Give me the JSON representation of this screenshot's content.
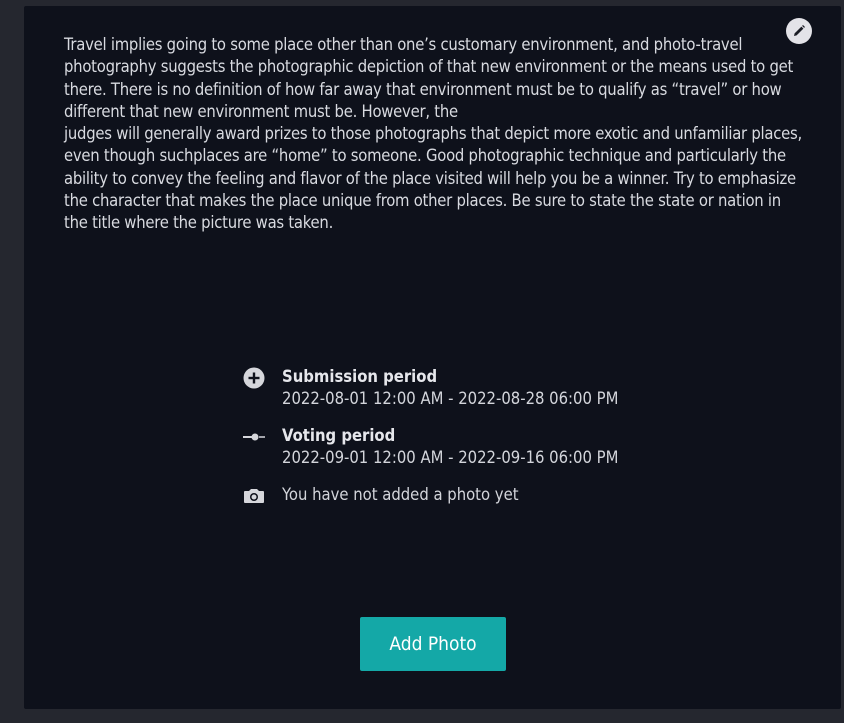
{
  "description": {
    "paragraph1": "Travel implies going to some place other than one’s customary environment, and photo-travel photography suggests the photographic depiction of that new environment or the means used to get there. There is no definition of how far away that environment must be to qualify as “travel” or how different that new environment must be. However, the",
    "paragraph2": "judges will generally award prizes to those photographs that depict more exotic and unfamiliar places, even though suchplaces are “home” to someone. Good photographic technique and particularly the ability to convey the feeling and flavor of the place visited will help you be a winner. Try to emphasize the character that makes the place unique from other places. Be sure to state the state or nation in the title where the picture was taken."
  },
  "edit_icon": "pencil-icon",
  "submission": {
    "icon": "plus-circle-icon",
    "heading": "Submission period",
    "value": "2022-08-01 12:00 AM - 2022-08-28 06:00 PM"
  },
  "voting": {
    "icon": "voting-arrow-icon",
    "heading": "Voting period",
    "value": "2022-09-01 12:00 AM - 2022-09-16 06:00 PM"
  },
  "photo_status": {
    "icon": "camera-icon",
    "text": "You have not added a photo yet"
  },
  "add_photo_button": {
    "label": "Add Photo"
  },
  "colors": {
    "page_background": "#25272f",
    "card_background": "#0e111b",
    "text": "#d8dae0",
    "accent": "#14a8a7"
  }
}
